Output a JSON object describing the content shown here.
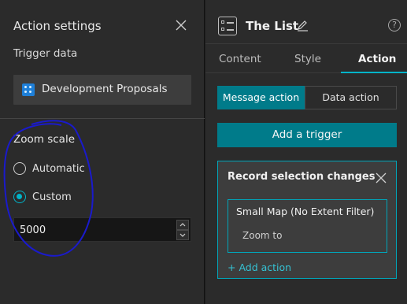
{
  "left_panel": {
    "title": "Action settings",
    "trigger_label": "Trigger data",
    "data_source": "Development Proposals",
    "zoom_scale_label": "Zoom scale",
    "radio_options": [
      {
        "label": "Automatic",
        "checked": false
      },
      {
        "label": "Custom",
        "checked": true
      }
    ],
    "zoom_value": "5000"
  },
  "right_panel": {
    "widget_title": "The List",
    "help_symbol": "?",
    "tabs": [
      {
        "label": "Content",
        "active": false
      },
      {
        "label": "Style",
        "active": false
      },
      {
        "label": "Action",
        "active": true
      }
    ],
    "segment": {
      "message_action": "Message action",
      "data_action": "Data action",
      "selected": "Message action"
    },
    "add_trigger_label": "Add a trigger",
    "trigger_card": {
      "title": "Record selection changes",
      "target_widget": "Small Map (No Extent Filter)",
      "action": "Zoom to",
      "add_action_label": "+ Add action"
    }
  },
  "colors": {
    "accent": "#00b4c9",
    "button_teal": "#007b8a",
    "panel_bg": "#2b2b2b",
    "annotation": "#1a1acc"
  },
  "icons": [
    "close-icon",
    "layer-icon",
    "radio-icon",
    "spin-up-icon",
    "spin-down-icon",
    "list-widget-icon",
    "edit-icon",
    "help-icon"
  ]
}
